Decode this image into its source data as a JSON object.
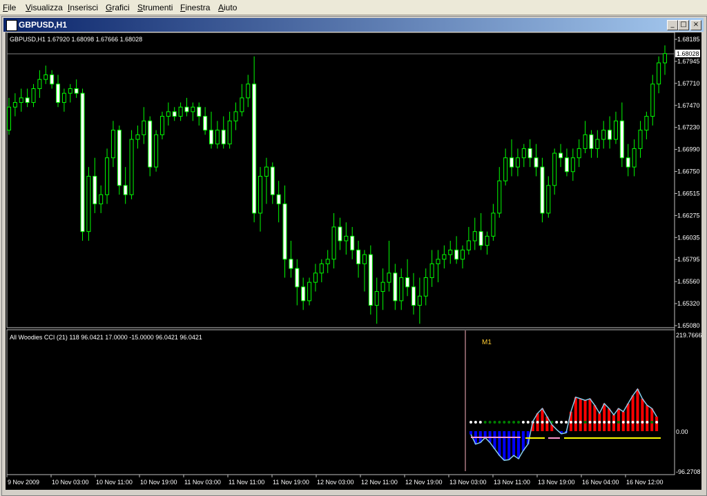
{
  "menu": [
    "File",
    "Visualizza",
    "Inserisci",
    "Grafici",
    "Strumenti",
    "Finestra",
    "Aiuto"
  ],
  "window": {
    "title": "GBPUSD,H1",
    "buttons": {
      "minimize": "_",
      "restore": "□",
      "close": "×"
    }
  },
  "main_chart": {
    "header": "GBPUSD,H1  1.67920 1.68098 1.67666 1.68028",
    "current_price": "1.68028",
    "price_labels": [
      "1.68185",
      "1.67945",
      "1.67710",
      "1.67470",
      "1.67230",
      "1.66990",
      "1.66750",
      "1.66515",
      "1.66275",
      "1.66035",
      "1.65795",
      "1.65560",
      "1.65320",
      "1.65080"
    ]
  },
  "indicator": {
    "header": "All Woodies CCI (21) 118 96.0421 17.0000 -15.0000 96.0421 96.0421",
    "timeframe_label": "M1",
    "scale_labels": [
      "219.7666",
      "0.00",
      "-96.2708"
    ]
  },
  "time_axis": [
    "9 Nov 2009",
    "10 Nov 03:00",
    "10 Nov 11:00",
    "10 Nov 19:00",
    "11 Nov 03:00",
    "11 Nov 11:00",
    "11 Nov 19:00",
    "12 Nov 03:00",
    "12 Nov 11:00",
    "12 Nov 19:00",
    "13 Nov 03:00",
    "13 Nov 11:00",
    "13 Nov 19:00",
    "16 Nov 04:00",
    "16 Nov 12:00"
  ],
  "colors": {
    "candle": "#00ff00",
    "candle_up_fill": "#000000",
    "candle_down_fill": "#ffffff",
    "cci_line": "#87ceeb",
    "hist_pos": "#ff0000",
    "hist_neg": "#0000ff",
    "dot_white": "#ffffff",
    "dot_green": "#008000",
    "line_yellow": "#ffff00",
    "line_pink": "#ff99cc"
  },
  "chart_data": {
    "type": "candlestick",
    "ylim": [
      1.6508,
      1.68185
    ],
    "ohlc": [
      [
        1.672,
        1.6755,
        1.6715,
        1.6745
      ],
      [
        1.6745,
        1.676,
        1.6735,
        1.675
      ],
      [
        1.675,
        1.6765,
        1.674,
        1.6755
      ],
      [
        1.6755,
        1.6765,
        1.6745,
        1.675
      ],
      [
        1.675,
        1.677,
        1.6745,
        1.6765
      ],
      [
        1.6765,
        1.6785,
        1.6755,
        1.6775
      ],
      [
        1.6775,
        1.679,
        1.677,
        1.678
      ],
      [
        1.678,
        1.6785,
        1.6765,
        1.677
      ],
      [
        1.677,
        1.678,
        1.6745,
        1.675
      ],
      [
        1.675,
        1.6765,
        1.674,
        1.676
      ],
      [
        1.676,
        1.677,
        1.675,
        1.6765
      ],
      [
        1.6765,
        1.6775,
        1.6755,
        1.676
      ],
      [
        1.676,
        1.6765,
        1.66,
        1.661
      ],
      [
        1.661,
        1.668,
        1.66,
        1.667
      ],
      [
        1.667,
        1.669,
        1.663,
        1.664
      ],
      [
        1.664,
        1.666,
        1.663,
        1.665
      ],
      [
        1.665,
        1.67,
        1.664,
        1.669
      ],
      [
        1.669,
        1.673,
        1.668,
        1.672
      ],
      [
        1.672,
        1.6725,
        1.665,
        1.666
      ],
      [
        1.666,
        1.668,
        1.664,
        1.665
      ],
      [
        1.665,
        1.672,
        1.6645,
        1.671
      ],
      [
        1.671,
        1.6725,
        1.67,
        1.6715
      ],
      [
        1.6715,
        1.6745,
        1.6705,
        1.673
      ],
      [
        1.673,
        1.6735,
        1.667,
        1.668
      ],
      [
        1.668,
        1.672,
        1.6675,
        1.6715
      ],
      [
        1.6715,
        1.674,
        1.671,
        1.6735
      ],
      [
        1.6735,
        1.675,
        1.6725,
        1.674
      ],
      [
        1.674,
        1.6745,
        1.673,
        1.6735
      ],
      [
        1.6735,
        1.675,
        1.673,
        1.6745
      ],
      [
        1.6745,
        1.6755,
        1.6735,
        1.674
      ],
      [
        1.674,
        1.675,
        1.673,
        1.6745
      ],
      [
        1.6745,
        1.675,
        1.6725,
        1.6735
      ],
      [
        1.6735,
        1.6745,
        1.6715,
        1.672
      ],
      [
        1.672,
        1.674,
        1.67,
        1.6705
      ],
      [
        1.6705,
        1.673,
        1.67,
        1.672
      ],
      [
        1.672,
        1.6735,
        1.67,
        1.6705
      ],
      [
        1.6705,
        1.674,
        1.67,
        1.673
      ],
      [
        1.673,
        1.675,
        1.672,
        1.674
      ],
      [
        1.674,
        1.677,
        1.6735,
        1.6755
      ],
      [
        1.6755,
        1.678,
        1.6745,
        1.677
      ],
      [
        1.677,
        1.68,
        1.662,
        1.663
      ],
      [
        1.663,
        1.668,
        1.661,
        1.667
      ],
      [
        1.667,
        1.669,
        1.664,
        1.668
      ],
      [
        1.668,
        1.6685,
        1.664,
        1.665
      ],
      [
        1.665,
        1.6665,
        1.662,
        1.664
      ],
      [
        1.664,
        1.666,
        1.656,
        1.658
      ],
      [
        1.658,
        1.66,
        1.656,
        1.657
      ],
      [
        1.657,
        1.658,
        1.653,
        1.655
      ],
      [
        1.655,
        1.656,
        1.6525,
        1.6535
      ],
      [
        1.6535,
        1.656,
        1.653,
        1.6555
      ],
      [
        1.6555,
        1.6575,
        1.6545,
        1.6565
      ],
      [
        1.6565,
        1.658,
        1.6555,
        1.6575
      ],
      [
        1.6575,
        1.659,
        1.6565,
        1.658
      ],
      [
        1.658,
        1.663,
        1.657,
        1.6615
      ],
      [
        1.6615,
        1.6625,
        1.659,
        1.66
      ],
      [
        1.66,
        1.662,
        1.6585,
        1.6605
      ],
      [
        1.6605,
        1.6615,
        1.658,
        1.659
      ],
      [
        1.659,
        1.66,
        1.656,
        1.6575
      ],
      [
        1.6575,
        1.659,
        1.6545,
        1.6585
      ],
      [
        1.6585,
        1.6595,
        1.652,
        1.653
      ],
      [
        1.653,
        1.656,
        1.651,
        1.6545
      ],
      [
        1.6545,
        1.657,
        1.6525,
        1.6555
      ],
      [
        1.6555,
        1.66,
        1.6545,
        1.6565
      ],
      [
        1.6565,
        1.6575,
        1.6525,
        1.6535
      ],
      [
        1.6535,
        1.657,
        1.6525,
        1.656
      ],
      [
        1.656,
        1.658,
        1.654,
        1.655
      ],
      [
        1.655,
        1.6565,
        1.652,
        1.653
      ],
      [
        1.653,
        1.656,
        1.651,
        1.654
      ],
      [
        1.654,
        1.657,
        1.653,
        1.656
      ],
      [
        1.656,
        1.659,
        1.655,
        1.6575
      ],
      [
        1.6575,
        1.659,
        1.6555,
        1.658
      ],
      [
        1.658,
        1.6595,
        1.657,
        1.6585
      ],
      [
        1.6585,
        1.66,
        1.6575,
        1.659
      ],
      [
        1.659,
        1.6605,
        1.6575,
        1.658
      ],
      [
        1.658,
        1.6595,
        1.657,
        1.659
      ],
      [
        1.659,
        1.6615,
        1.6585,
        1.66
      ],
      [
        1.66,
        1.6625,
        1.659,
        1.661
      ],
      [
        1.661,
        1.663,
        1.659,
        1.6595
      ],
      [
        1.6595,
        1.661,
        1.6585,
        1.6605
      ],
      [
        1.6605,
        1.664,
        1.66,
        1.663
      ],
      [
        1.663,
        1.668,
        1.6625,
        1.6665
      ],
      [
        1.6665,
        1.67,
        1.666,
        1.669
      ],
      [
        1.669,
        1.671,
        1.667,
        1.668
      ],
      [
        1.668,
        1.67,
        1.667,
        1.669
      ],
      [
        1.669,
        1.6705,
        1.668,
        1.67
      ],
      [
        1.67,
        1.671,
        1.668,
        1.669
      ],
      [
        1.669,
        1.6705,
        1.667,
        1.668
      ],
      [
        1.668,
        1.669,
        1.662,
        1.663
      ],
      [
        1.663,
        1.667,
        1.6625,
        1.666
      ],
      [
        1.666,
        1.67,
        1.665,
        1.6695
      ],
      [
        1.6695,
        1.6705,
        1.668,
        1.669
      ],
      [
        1.669,
        1.67,
        1.667,
        1.6675
      ],
      [
        1.6675,
        1.67,
        1.6665,
        1.669
      ],
      [
        1.669,
        1.671,
        1.668,
        1.67
      ],
      [
        1.67,
        1.673,
        1.6695,
        1.6715
      ],
      [
        1.6715,
        1.672,
        1.669,
        1.67
      ],
      [
        1.67,
        1.672,
        1.669,
        1.671
      ],
      [
        1.671,
        1.673,
        1.67,
        1.672
      ],
      [
        1.672,
        1.6735,
        1.67,
        1.671
      ],
      [
        1.671,
        1.674,
        1.6705,
        1.673
      ],
      [
        1.673,
        1.675,
        1.668,
        1.669
      ],
      [
        1.669,
        1.6705,
        1.667,
        1.668
      ],
      [
        1.668,
        1.671,
        1.667,
        1.67
      ],
      [
        1.67,
        1.673,
        1.669,
        1.672
      ],
      [
        1.672,
        1.674,
        1.671,
        1.6735
      ],
      [
        1.6735,
        1.678,
        1.6725,
        1.677
      ],
      [
        1.677,
        1.68,
        1.676,
        1.6793
      ],
      [
        1.6793,
        1.6812,
        1.678,
        1.6803
      ]
    ]
  }
}
